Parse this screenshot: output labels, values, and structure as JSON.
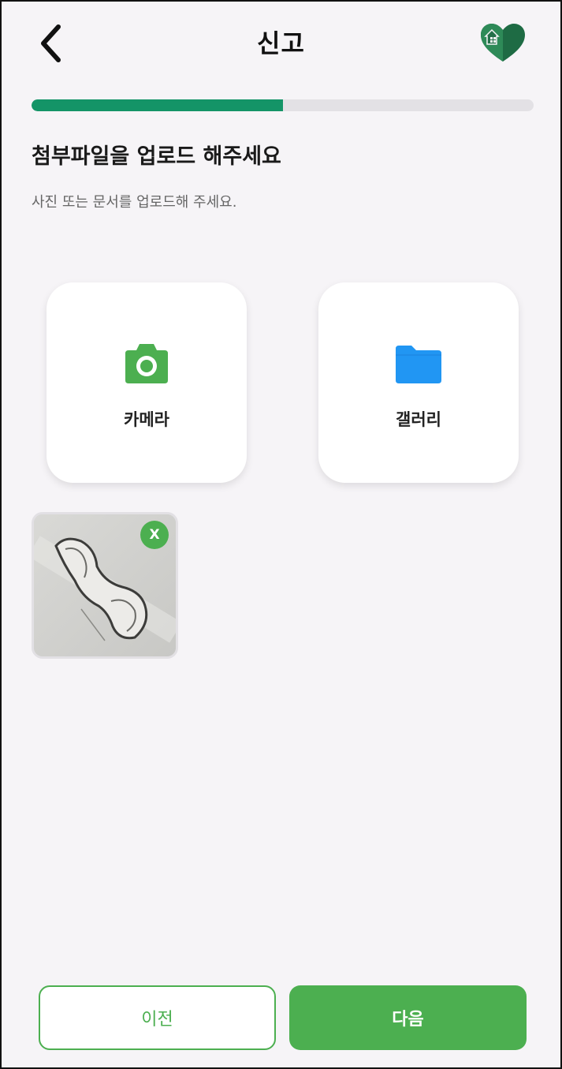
{
  "header": {
    "title": "신고"
  },
  "progress": {
    "fraction": 0.5
  },
  "content": {
    "heading": "첨부파일을 업로드 해주세요",
    "subtext": "사진 또는 문서를 업로드해 주세요."
  },
  "options": {
    "camera_label": "카메라",
    "gallery_label": "갤러리"
  },
  "attachments": {
    "remove_label": "X"
  },
  "footer": {
    "prev_label": "이전",
    "next_label": "다음"
  },
  "colors": {
    "accent_green": "#4caf50",
    "progress_green": "#149467",
    "folder_blue": "#2196f3",
    "background": "#f6f4f7"
  },
  "icons": {
    "back": "chevron-left-icon",
    "logo": "heart-house-logo",
    "camera": "camera-icon",
    "gallery": "folder-icon",
    "remove": "close-icon"
  }
}
